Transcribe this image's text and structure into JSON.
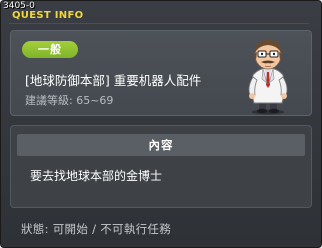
{
  "window": {
    "id_label": "3405-0",
    "title": "QUEST INFO"
  },
  "quest": {
    "category_badge": "一般",
    "name": "[地球防御本部] 重要机器人配件",
    "recommended_level": "建議等級: 65~69",
    "npc_icon": "doctor-npc-icon"
  },
  "content": {
    "header": "內容",
    "text": "要去找地球本部的金博士"
  },
  "status": {
    "text": "狀態: 可開始 / 不可執行任務"
  },
  "colors": {
    "title": "#f0d63a",
    "badge": "#8fc131",
    "panel": "#44494f"
  }
}
